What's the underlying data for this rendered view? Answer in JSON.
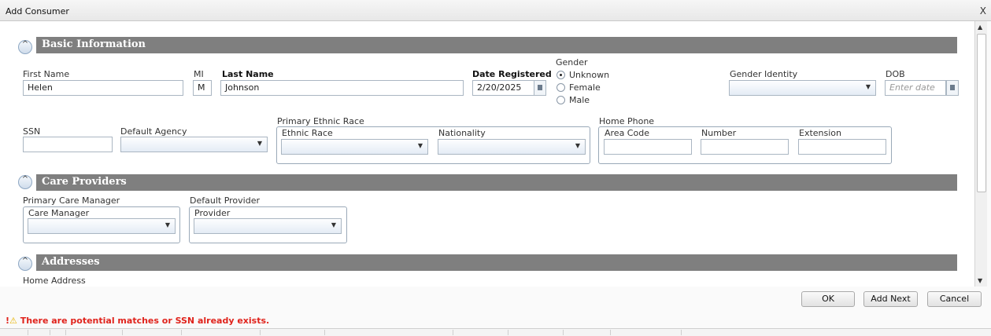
{
  "window": {
    "title": "Add Consumer",
    "close": "X"
  },
  "sections": {
    "basic": "Basic Information",
    "care": "Care Providers",
    "addresses": "Addresses"
  },
  "toggle_glyph": "^",
  "basic": {
    "first_name": {
      "label": "First Name",
      "value": "Helen"
    },
    "mi": {
      "label": "MI",
      "value": "M"
    },
    "last_name": {
      "label": "Last Name",
      "value": "Johnson"
    },
    "date_registered": {
      "label": "Date Registered",
      "value": "2/20/2025"
    },
    "gender": {
      "label": "Gender",
      "options": [
        "Unknown",
        "Female",
        "Male"
      ],
      "selected": "Unknown"
    },
    "gender_identity": {
      "label": "Gender Identity",
      "value": ""
    },
    "dob": {
      "label": "DOB",
      "placeholder": "Enter date"
    },
    "ssn": {
      "label": "SSN",
      "value": ""
    },
    "default_agency": {
      "label": "Default Agency",
      "value": ""
    },
    "primary_ethnic_race": {
      "label": "Primary Ethnic Race",
      "ethnic_race": "Ethnic Race",
      "nationality": "Nationality"
    },
    "home_phone": {
      "label": "Home Phone",
      "area_code": "Area Code",
      "number": "Number",
      "extension": "Extension"
    }
  },
  "care": {
    "primary_care_manager": {
      "label": "Primary Care Manager",
      "field": "Care Manager"
    },
    "default_provider": {
      "label": "Default Provider",
      "field": "Provider"
    }
  },
  "addresses": {
    "home_address": "Home Address"
  },
  "buttons": {
    "ok": "OK",
    "add_next": "Add Next",
    "cancel": "Cancel"
  },
  "warning": {
    "icon_error": "!",
    "icon_warn": "⚠",
    "text": "There are potential matches or SSN already exists."
  },
  "colors": {
    "section_bar": "#7f7f7f",
    "warning_text": "#e0231c"
  }
}
